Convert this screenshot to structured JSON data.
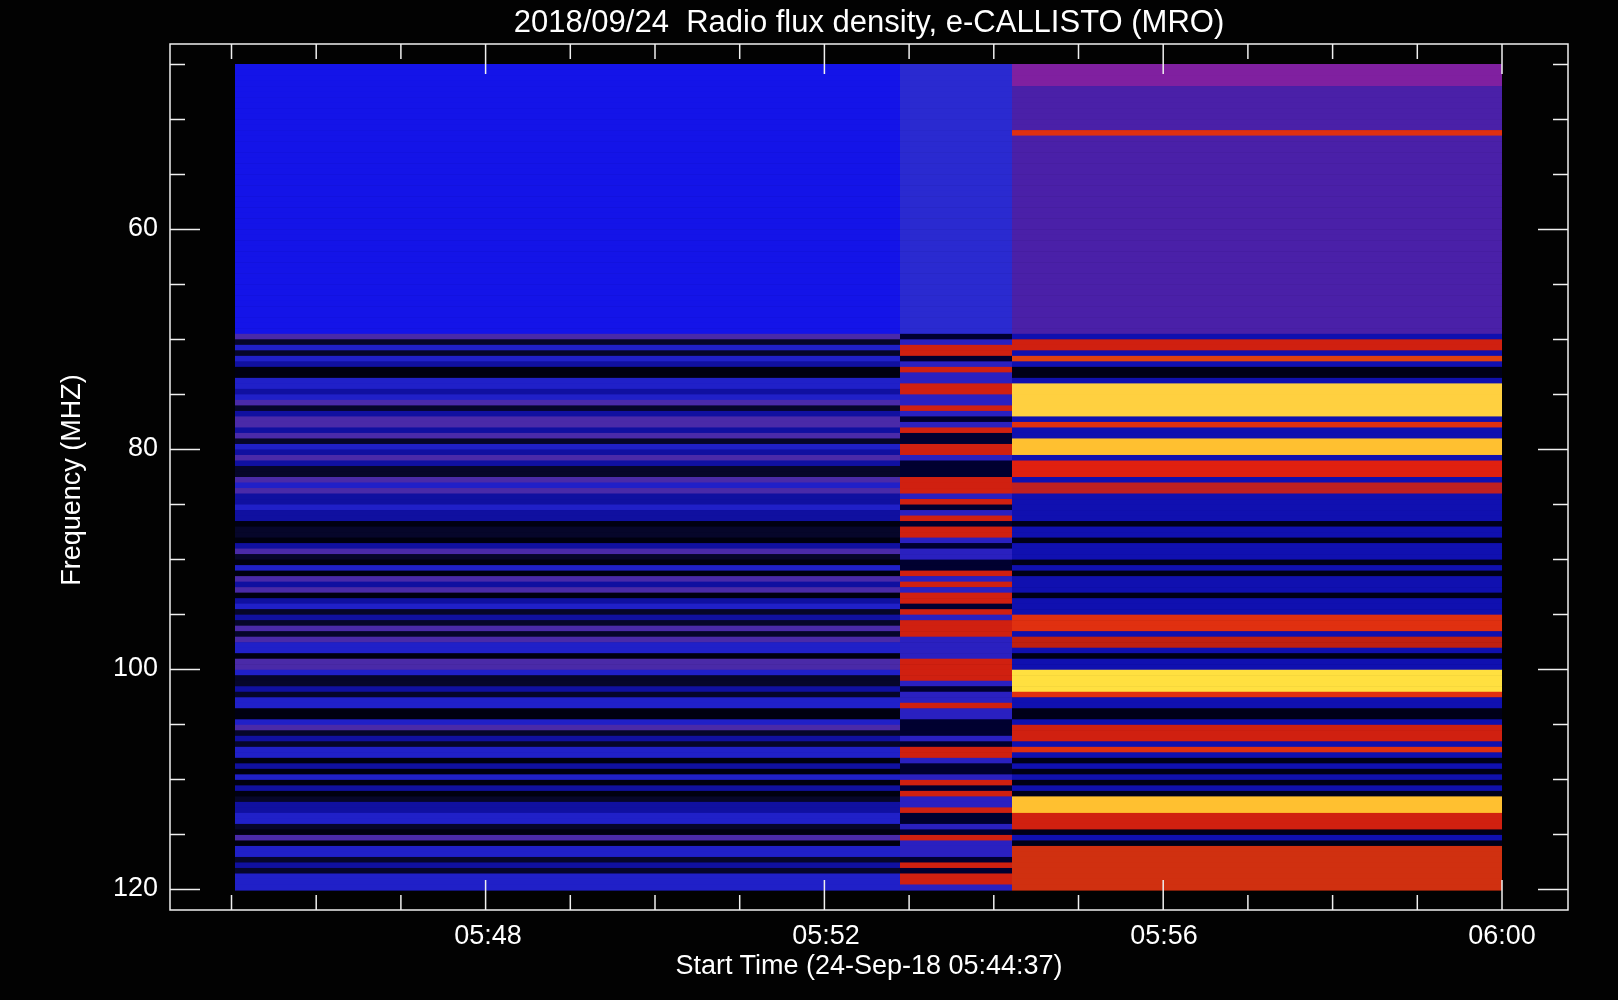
{
  "title": "2018/09/24  Radio flux density, e-CALLISTO (MRO)",
  "y_axis": {
    "label": "Frequency (MHZ)",
    "ticks": [
      "60",
      "80",
      "100",
      "120"
    ]
  },
  "x_axis": {
    "label": "Start Time (24-Sep-18 05:44:37)",
    "ticks": [
      "05:48",
      "05:52",
      "05:56",
      "06:00"
    ]
  }
}
